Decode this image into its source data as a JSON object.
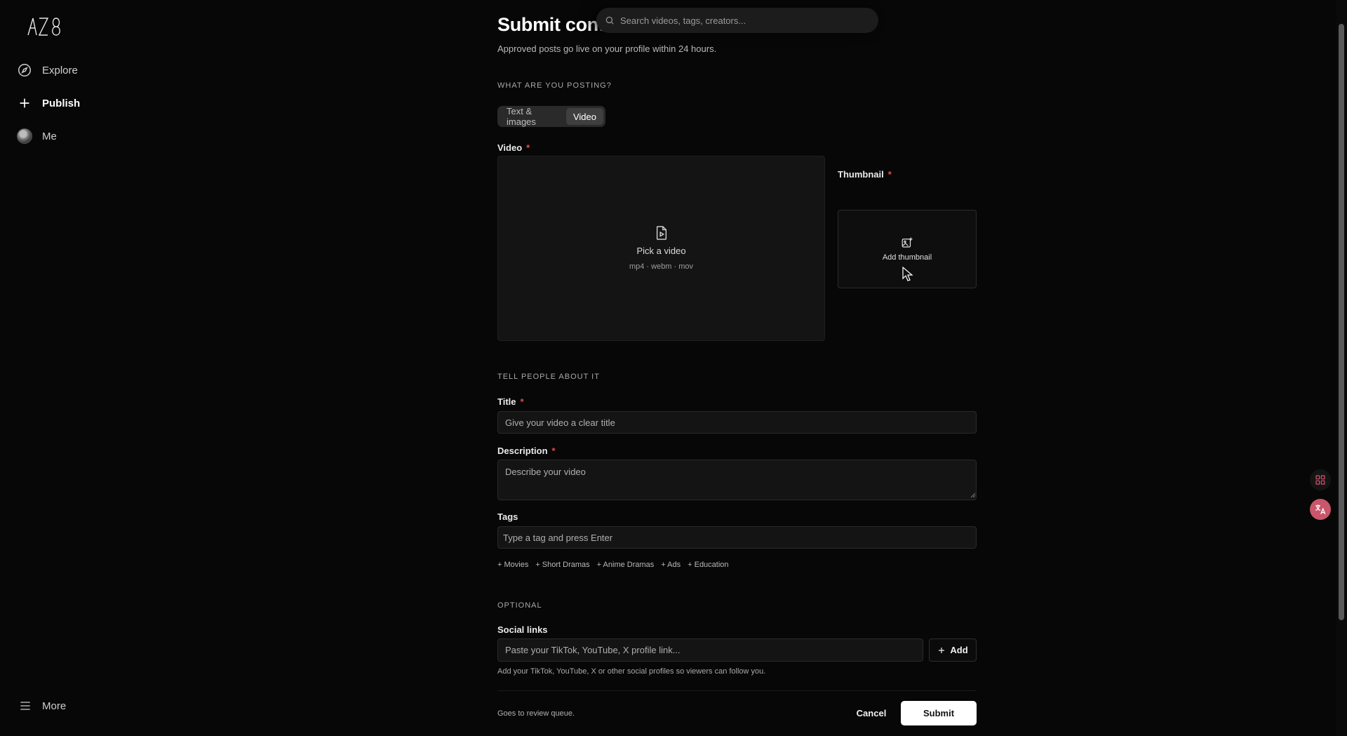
{
  "sidebar": {
    "logo_text": "AZ8",
    "items": [
      {
        "label": "Explore",
        "icon": "compass-icon"
      },
      {
        "label": "Publish",
        "icon": "plus-icon"
      },
      {
        "label": "Me",
        "icon": "avatar"
      }
    ],
    "more_label": "More"
  },
  "search": {
    "placeholder": "Search videos, tags, creators..."
  },
  "header": {
    "title": "Submit conte",
    "subtitle": "Approved posts go live on your profile within 24 hours."
  },
  "posting": {
    "section_label": "WHAT ARE YOU POSTING?",
    "options": [
      "Text & images",
      "Video"
    ],
    "selected": "Video"
  },
  "video": {
    "label": "Video",
    "required_mark": "*",
    "pick_text": "Pick a video",
    "formats": "mp4 · webm · mov"
  },
  "thumbnail": {
    "label": "Thumbnail",
    "required_mark": "*",
    "add_text": "Add thumbnail"
  },
  "about": {
    "section_label": "TELL PEOPLE ABOUT IT",
    "title_label": "Title",
    "title_placeholder": "Give your video a clear title",
    "description_label": "Description",
    "description_placeholder": "Describe your video",
    "tags_label": "Tags",
    "tags_placeholder": "Type a tag and press Enter",
    "tag_suggestions": [
      "+ Movies",
      "+ Short Dramas",
      "+ Anime Dramas",
      "+ Ads",
      "+ Education"
    ]
  },
  "optional": {
    "section_label": "OPTIONAL",
    "social_label": "Social links",
    "social_placeholder": "Paste your TikTok, YouTube, X profile link...",
    "add_label": "Add",
    "hint": "Add your TikTok, YouTube, X or other social profiles so viewers can follow you."
  },
  "footer": {
    "review_note": "Goes to review queue.",
    "cancel_label": "Cancel",
    "submit_label": "Submit"
  },
  "colors": {
    "background": "#070707",
    "required": "#e34b4b",
    "accent_pink": "#d9536d"
  }
}
